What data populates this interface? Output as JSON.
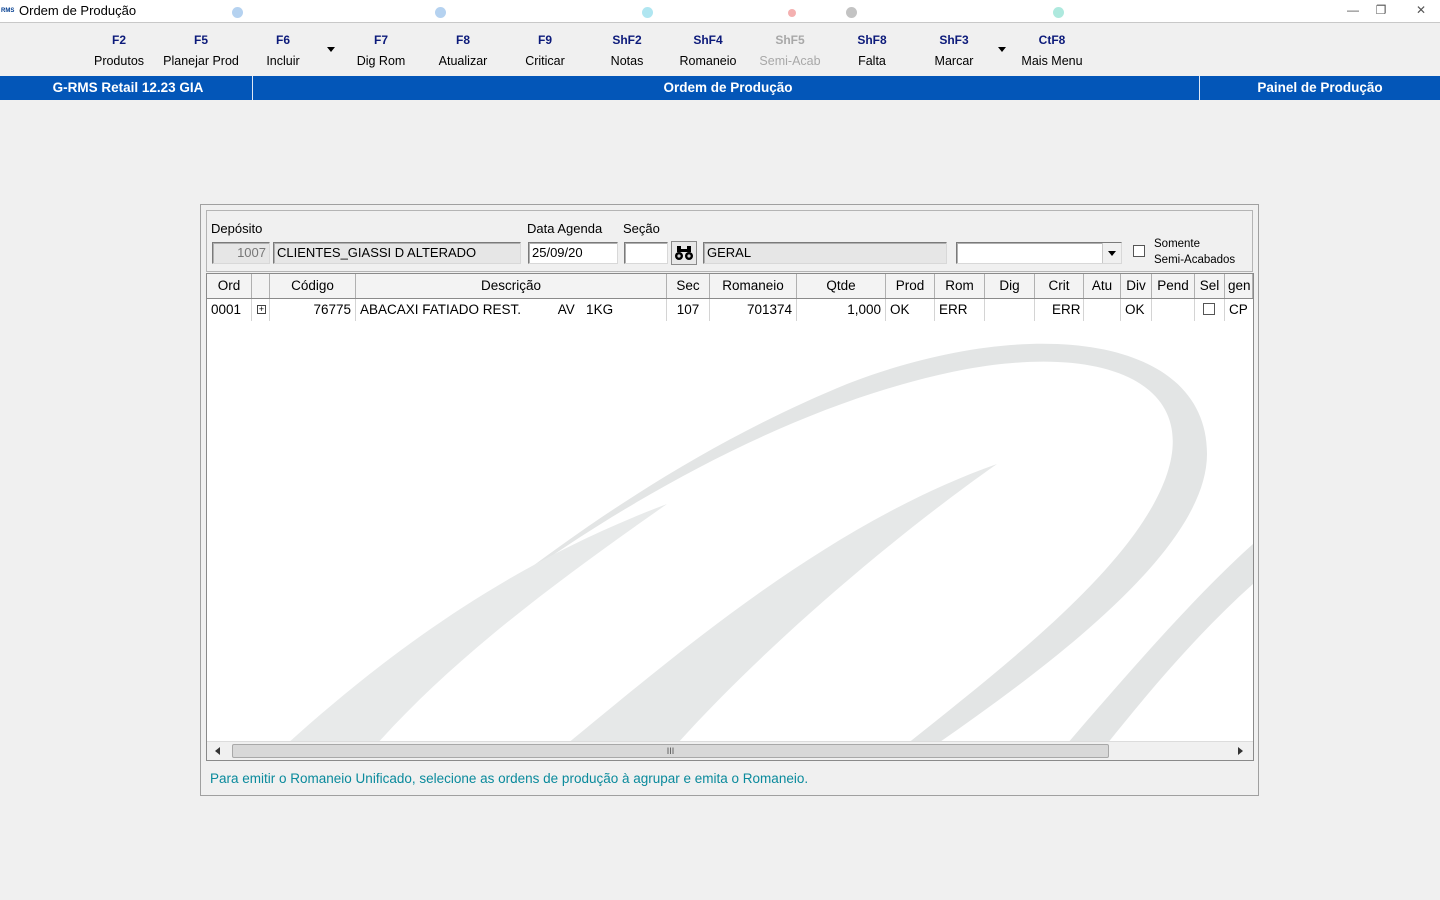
{
  "window": {
    "app_icon_text": "RMS",
    "title": "Ordem de Produção",
    "minimize": "—",
    "restore": "❐",
    "close": "✕"
  },
  "toolbar": {
    "buttons": [
      {
        "key": "F2",
        "label": "Produtos",
        "enabled": true
      },
      {
        "key": "F5",
        "label": "Planejar Prod",
        "enabled": true
      },
      {
        "key": "F6",
        "label": "Incluir",
        "enabled": true,
        "has_dropdown": true
      },
      {
        "key": "F7",
        "label": "Dig Rom",
        "enabled": true
      },
      {
        "key": "F8",
        "label": "Atualizar",
        "enabled": true
      },
      {
        "key": "F9",
        "label": "Criticar",
        "enabled": true
      },
      {
        "key": "ShF2",
        "label": "Notas",
        "enabled": true
      },
      {
        "key": "ShF4",
        "label": "Romaneio",
        "enabled": true
      },
      {
        "key": "ShF5",
        "label": "Semi-Acab",
        "enabled": false
      },
      {
        "key": "ShF8",
        "label": "Falta",
        "enabled": true
      },
      {
        "key": "ShF3",
        "label": "Marcar",
        "enabled": true,
        "has_dropdown": true
      },
      {
        "key": "CtF8",
        "label": "Mais Menu",
        "enabled": true
      }
    ]
  },
  "statusbar": {
    "left": "G-RMS Retail 12.23 GIA",
    "center": "Ordem de Produção",
    "right": "Painel de Produção",
    "color": "#0356b8"
  },
  "filters": {
    "deposito_label": "Depósito",
    "deposito_code": "1007",
    "deposito_name": "CLIENTES_GIASSI D ALTERADO",
    "data_label": "Data Agenda",
    "data_value": "25/09/20",
    "secao_label": "Seção",
    "secao_value": "",
    "secao_name": "GERAL",
    "combo_value": "",
    "somente_line1": "Somente",
    "somente_line2": "Semi-Acabados",
    "somente_checked": false
  },
  "grid": {
    "columns": [
      "Ord",
      "",
      "Código",
      "Descrição",
      "Sec",
      "Romaneio",
      "Qtde",
      "Prod",
      "Rom",
      "Dig",
      "Crit",
      "Atu",
      "Div",
      "Pend",
      "Sel",
      "gen"
    ],
    "rows": [
      {
        "ord": "0001",
        "expander": "+",
        "codigo": "76775",
        "descricao": "ABACAXI FATIADO REST.          AV   1KG",
        "sec": "107",
        "romaneio": "701374",
        "qtde": "1,000",
        "prod": "OK",
        "rom": "ERR",
        "dig": "",
        "crit": "ERR",
        "atu": "",
        "div": "OK",
        "pend": "",
        "sel": false,
        "gen": "CP"
      }
    ],
    "scroll_thumb_glyph": "III"
  },
  "hint": "Para emitir o Romaneio Unificado, selecione as ordens de produção à agrupar e emita o Romaneio.",
  "colors": {
    "hint": "#0a8a9c",
    "toolbar_key": "#0c1a7a"
  }
}
